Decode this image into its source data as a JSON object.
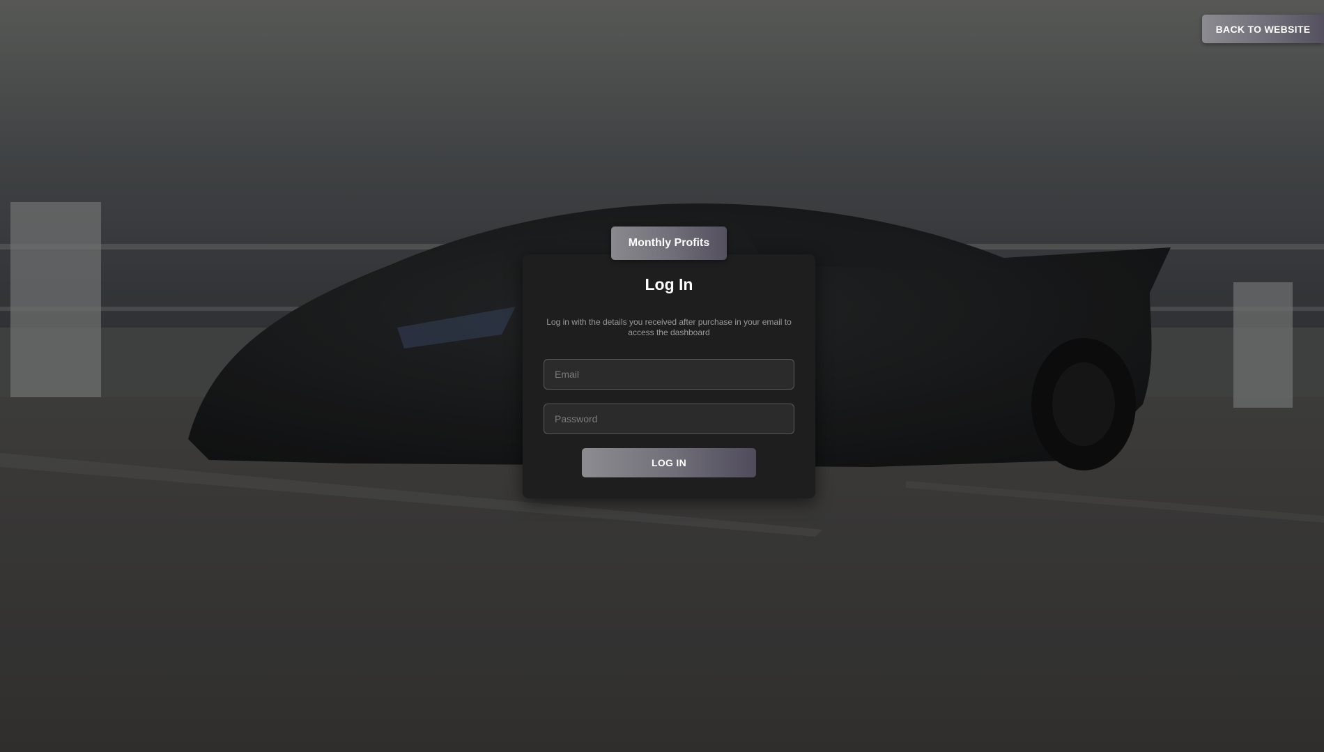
{
  "header": {
    "back_label": "BACK TO WEBSITE"
  },
  "login": {
    "tab_label": "Monthly Profits",
    "title": "Log In",
    "description": "Log in with the details you received after purchase in your email to access the dashboard",
    "email_placeholder": "Email",
    "password_placeholder": "Password",
    "submit_label": "LOG IN"
  },
  "background": {
    "subject": "sports-car-photo"
  },
  "colors": {
    "card_bg": "#1e1e1e",
    "accent_gradient_start": "#8c8b90",
    "accent_gradient_end": "#54505f"
  }
}
